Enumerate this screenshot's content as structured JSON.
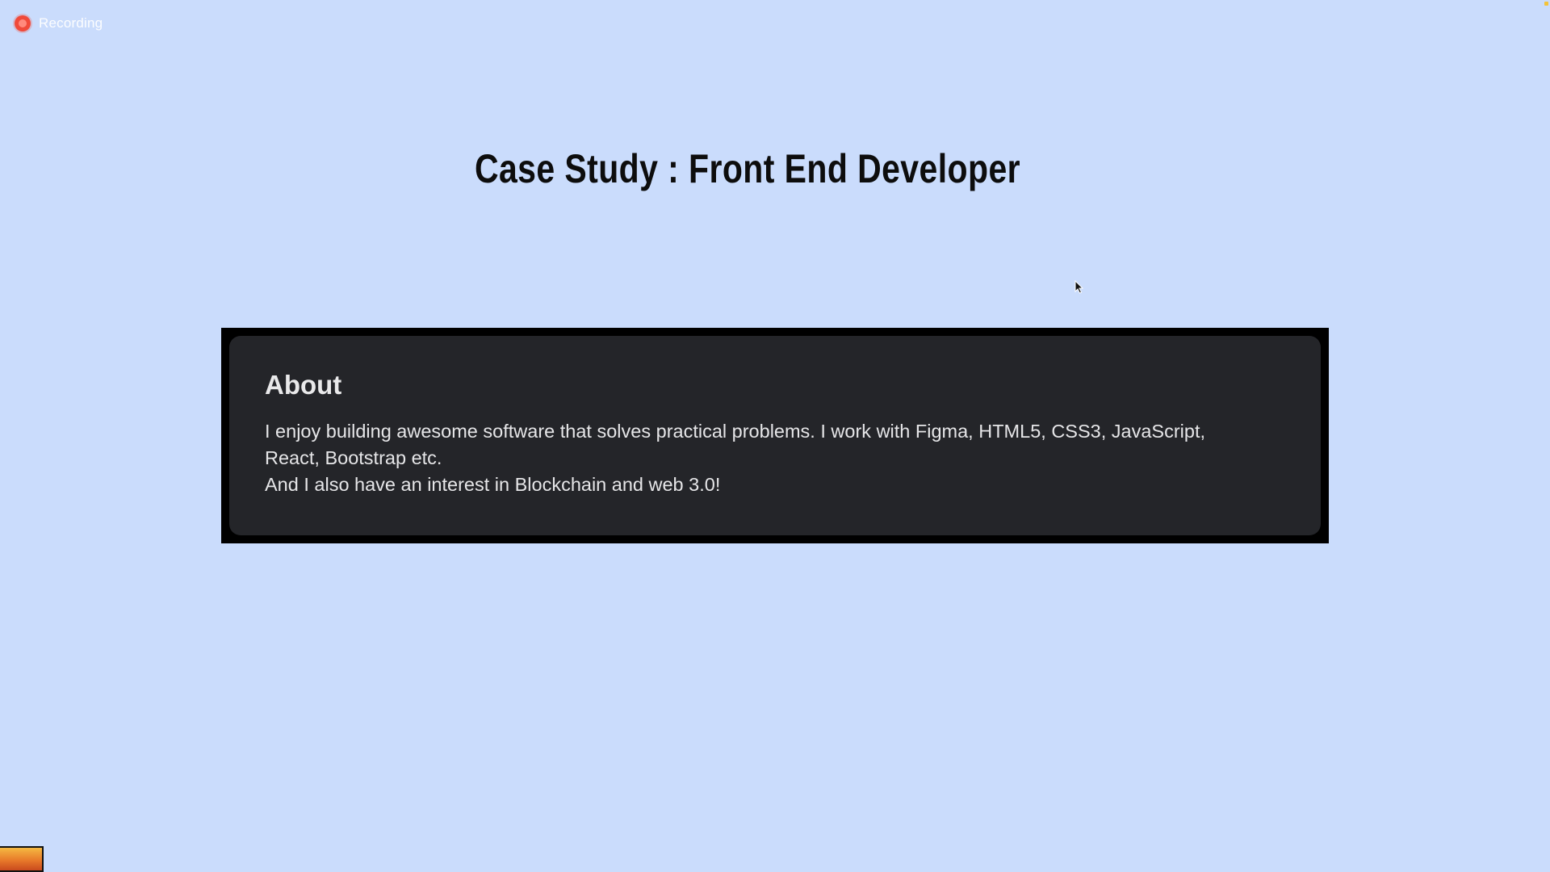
{
  "recording": {
    "label": "Recording",
    "dot_color": "#f04a3a",
    "icon": "record-icon"
  },
  "page": {
    "title": "Case Study : Front End Developer",
    "background": "#cadcfc"
  },
  "about": {
    "heading": "About",
    "line1": "I enjoy building awesome software that solves practical problems. I work with Figma, HTML5, CSS3, JavaScript,",
    "line2": "React, Bootstrap etc.",
    "line3": "And I also have an interest in Blockchain and web 3.0!",
    "card_color": "#242529",
    "frame_color": "#000000"
  },
  "overlay": {
    "cursor_icon": "mouse-pointer-icon",
    "thumbnail_icon": "webcam-thumbnail-icon"
  }
}
